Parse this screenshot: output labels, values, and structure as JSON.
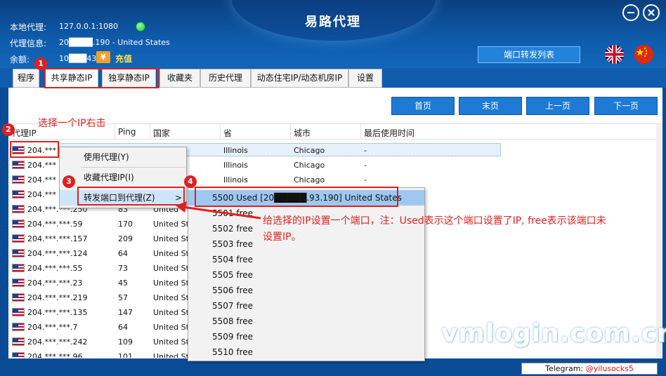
{
  "app": {
    "title": "易路代理"
  },
  "info": {
    "local_proxy_label": "本地代理:",
    "local_proxy_value": "127.0.0.1:1080",
    "proxy_info_label": "代理信息:",
    "proxy_info_value": "20████.190 - United States",
    "balance_label": "余额:",
    "balance_value": "10███43",
    "yuan_symbol": "¥",
    "recharge_label": "充值"
  },
  "header": {
    "port_forward_list": "端口转发列表"
  },
  "tabs": [
    {
      "label": "程序"
    },
    {
      "label": "共享静态IP"
    },
    {
      "label": "独享静态IP"
    },
    {
      "label": "收藏夹"
    },
    {
      "label": "历史代理"
    },
    {
      "label": "动态住宅IP/动态机房IP"
    },
    {
      "label": "设置"
    }
  ],
  "pager": {
    "first": "首页",
    "last": "末页",
    "prev": "上一页",
    "next": "下一页"
  },
  "columns": [
    "代理IP",
    "Ping",
    "国家",
    "省",
    "城市",
    "最后使用时间"
  ],
  "rows": [
    {
      "ip": "204.***",
      "ping": "",
      "country": "es",
      "province": "Illinois",
      "city": "Chicago",
      "last_used": "-"
    },
    {
      "ip": "204.***",
      "ping": "",
      "country": "es",
      "province": "Illinois",
      "city": "Chicago",
      "last_used": "-"
    },
    {
      "ip": "204.***",
      "ping": "",
      "country": "es",
      "province": "Illinois",
      "city": "Chicago",
      "last_used": "-"
    },
    {
      "ip": "204.***",
      "ping": "",
      "country": "",
      "province": "",
      "city": "",
      "last_used": ""
    },
    {
      "ip": "204.***.***.250",
      "ping": "83",
      "country": "United",
      "province": "",
      "city": "",
      "last_used": ""
    },
    {
      "ip": "204.***.***.59",
      "ping": "170",
      "country": "United Sta",
      "province": "",
      "city": "",
      "last_used": ""
    },
    {
      "ip": "204.***.***.157",
      "ping": "209",
      "country": "United Sta",
      "province": "",
      "city": "",
      "last_used": ""
    },
    {
      "ip": "204.***.***.124",
      "ping": "64",
      "country": "United Sta",
      "province": "",
      "city": "",
      "last_used": ""
    },
    {
      "ip": "204.***.***.55",
      "ping": "73",
      "country": "United Sta",
      "province": "",
      "city": "",
      "last_used": ""
    },
    {
      "ip": "204.***.***.23",
      "ping": "45",
      "country": "United Sta",
      "province": "",
      "city": "",
      "last_used": ""
    },
    {
      "ip": "204.***.***.219",
      "ping": "57",
      "country": "United Sta",
      "province": "",
      "city": "",
      "last_used": ""
    },
    {
      "ip": "204.***.***.135",
      "ping": "147",
      "country": "United Sta",
      "province": "",
      "city": "",
      "last_used": ""
    },
    {
      "ip": "204.***.***.7",
      "ping": "64",
      "country": "United Sta",
      "province": "",
      "city": "",
      "last_used": ""
    },
    {
      "ip": "204.***.***.242",
      "ping": "109",
      "country": "United Sta",
      "province": "",
      "city": "",
      "last_used": ""
    },
    {
      "ip": "204.***.***.96",
      "ping": "101",
      "country": "United Sta",
      "province": "",
      "city": "",
      "last_used": ""
    }
  ],
  "context_menu": {
    "use_proxy": "使用代理(Y)",
    "favorite_ip": "收藏代理IP(I)",
    "forward_port": "转发端口到代理(Z)",
    "arrow": ">"
  },
  "submenu": [
    "5500 Used [20█████.93.190] United States",
    "5501 free",
    "5502 free",
    "5503 free",
    "5504 free",
    "5505 free",
    "5506 free",
    "5507 free",
    "5508 free",
    "5509 free",
    "5510 free"
  ],
  "annotations": {
    "badge1": "1",
    "badge2": "2",
    "badge3": "3",
    "badge4": "4",
    "right_click_hint": "选择一个IP右击",
    "port_hint_line1": "给选择的IP设置一个端口，注：Used表示这个端口设置了IP, free表示该端口未",
    "port_hint_line2": "设置IP。"
  },
  "watermark": "vmlogin.com.cn",
  "telegram": {
    "prefix": "Telegram: ",
    "handle": "@yilusocks5"
  },
  "colors": {
    "header_blue": "#0f5cad",
    "annotation_red": "#e02020",
    "button_blue": "#1e7ad4"
  }
}
